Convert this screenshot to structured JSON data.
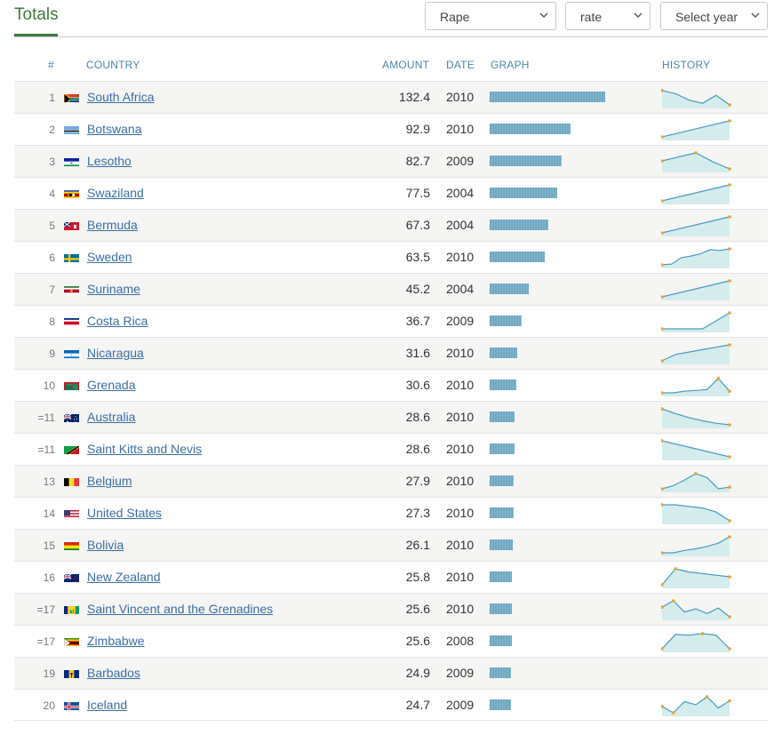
{
  "title": "Totals",
  "filters": {
    "crime": "Rape",
    "measure": "rate",
    "year": "Select year"
  },
  "columns": {
    "rank": "#",
    "country": "COUNTRY",
    "amount": "AMOUNT",
    "date": "DATE",
    "graph": "GRAPH",
    "history": "HISTORY"
  },
  "colors": {
    "accent": "#3d7a3d",
    "link": "#3a6ea5",
    "header": "#4b86a8",
    "bar": "#6ea6bf",
    "sparkline": "#4a9ac0",
    "sparkline_fill": "#d4ecec",
    "sparkline_point": "#f0a030"
  },
  "max_amount": 132.4,
  "rows": [
    {
      "rank": "1",
      "country": "South Africa",
      "flag": "za",
      "amount": "132.4",
      "date": "2010",
      "history": [
        0.9,
        0.7,
        0.3,
        0.1,
        0.6,
        0.0
      ]
    },
    {
      "rank": "2",
      "country": "Botswana",
      "flag": "bw",
      "amount": "92.9",
      "date": "2010",
      "history": [
        0.0,
        0.2,
        0.4,
        0.6,
        0.8,
        1.0
      ]
    },
    {
      "rank": "3",
      "country": "Lesotho",
      "flag": "ls",
      "amount": "82.7",
      "date": "2009",
      "history": [
        0.5,
        0.75,
        1.0,
        0.45,
        0.0
      ]
    },
    {
      "rank": "4",
      "country": "Swaziland",
      "flag": "sz",
      "amount": "77.5",
      "date": "2004",
      "history": [
        0.0,
        0.25,
        0.5,
        0.75,
        1.0
      ]
    },
    {
      "rank": "5",
      "country": "Bermuda",
      "flag": "bm",
      "amount": "67.3",
      "date": "2004",
      "history": [
        0.0,
        0.25,
        0.5,
        0.75,
        1.0
      ]
    },
    {
      "rank": "6",
      "country": "Sweden",
      "flag": "se",
      "amount": "63.5",
      "date": "2010",
      "history": [
        0.0,
        0.05,
        0.45,
        0.55,
        0.7,
        0.95,
        0.9,
        1.0
      ]
    },
    {
      "rank": "7",
      "country": "Suriname",
      "flag": "sr",
      "amount": "45.2",
      "date": "2004",
      "history": [
        0.0,
        0.25,
        0.5,
        0.75,
        1.0
      ]
    },
    {
      "rank": "8",
      "country": "Costa Rica",
      "flag": "cr",
      "amount": "36.7",
      "date": "2009",
      "history": [
        0.0,
        0.0,
        0.0,
        0.0,
        0.5,
        1.0
      ]
    },
    {
      "rank": "9",
      "country": "Nicaragua",
      "flag": "ni",
      "amount": "31.6",
      "date": "2010",
      "history": [
        0.0,
        0.4,
        0.55,
        0.7,
        0.85,
        1.0
      ]
    },
    {
      "rank": "10",
      "country": "Grenada",
      "flag": "gd",
      "amount": "30.6",
      "date": "2010",
      "history": [
        0.0,
        0.0,
        0.1,
        0.15,
        0.2,
        0.9,
        0.1
      ]
    },
    {
      "rank": "=11",
      "country": "Australia",
      "flag": "au",
      "amount": "28.6",
      "date": "2010",
      "history": [
        1.0,
        0.7,
        0.45,
        0.25,
        0.1,
        0.0
      ]
    },
    {
      "rank": "=11",
      "country": "Saint Kitts and Nevis",
      "flag": "kn",
      "amount": "28.6",
      "date": "2010",
      "history": [
        1.0,
        0.75,
        0.5,
        0.25,
        0.0
      ]
    },
    {
      "rank": "13",
      "country": "Belgium",
      "flag": "be",
      "amount": "27.9",
      "date": "2010",
      "history": [
        0.0,
        0.2,
        0.55,
        0.95,
        0.7,
        0.0,
        0.1
      ]
    },
    {
      "rank": "14",
      "country": "United States",
      "flag": "us",
      "amount": "27.3",
      "date": "2010",
      "history": [
        1.0,
        1.0,
        0.9,
        0.8,
        0.55,
        0.0
      ]
    },
    {
      "rank": "15",
      "country": "Bolivia",
      "flag": "bo",
      "amount": "26.1",
      "date": "2010",
      "history": [
        0.0,
        0.0,
        0.15,
        0.25,
        0.4,
        0.6,
        1.0
      ]
    },
    {
      "rank": "16",
      "country": "New Zealand",
      "flag": "nz",
      "amount": "25.8",
      "date": "2010",
      "history": [
        0.0,
        1.0,
        0.8,
        0.7,
        0.6,
        0.5
      ]
    },
    {
      "rank": "=17",
      "country": "Saint Vincent and the Grenadines",
      "flag": "vc",
      "amount": "25.6",
      "date": "2010",
      "history": [
        0.6,
        1.0,
        0.3,
        0.5,
        0.2,
        0.55,
        0.0
      ]
    },
    {
      "rank": "=17",
      "country": "Zimbabwe",
      "flag": "zw",
      "amount": "25.6",
      "date": "2008",
      "history": [
        0.0,
        0.9,
        0.85,
        0.95,
        0.85,
        0.0
      ]
    },
    {
      "rank": "19",
      "country": "Barbados",
      "flag": "bb",
      "amount": "24.9",
      "date": "2009",
      "history": []
    },
    {
      "rank": "20",
      "country": "Iceland",
      "flag": "is",
      "amount": "24.7",
      "date": "2009",
      "history": [
        0.4,
        0.0,
        0.7,
        0.5,
        1.0,
        0.3,
        0.75
      ]
    }
  ]
}
